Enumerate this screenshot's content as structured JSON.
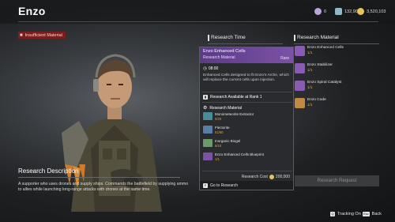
{
  "header": {
    "title": "Enzo",
    "currencies": [
      {
        "icon": "ticket-icon",
        "value": "0",
        "color": "#b9a3e0"
      },
      {
        "icon": "crystal-icon",
        "value": "132,908",
        "color": "#8fb8c9"
      },
      {
        "icon": "gold-coin-icon",
        "value": "3,520,103",
        "color": "#e8c25a"
      }
    ]
  },
  "status": {
    "insufficient": "Insufficient Material"
  },
  "research_time": {
    "label": "Research Time"
  },
  "research_material": {
    "label": "Research Material"
  },
  "materials": [
    {
      "name": "Enzo Enhanced Cells",
      "count": "1/1",
      "color": "#8a5bb5"
    },
    {
      "name": "Enzo Stabilizer",
      "count": "1/1",
      "color": "#8a5bb5"
    },
    {
      "name": "Enzo Spiral Catalyst",
      "count": "1/1",
      "color": "#8a5bb5"
    },
    {
      "name": "Enzo Code",
      "count": "1/1",
      "color": "#c08b3e"
    }
  ],
  "request_button": "Research Request",
  "popup": {
    "name": "Enzo Enhanced Cells",
    "type": "Research Material",
    "rarity": "Rare",
    "time": "08:00",
    "description": "Enhanced Cells designed to fit Enzo's Arche, which will replace the current cells upon injection.",
    "rank": "Research Available at Rank 1",
    "materials_label": "Research Material",
    "items": [
      {
        "name": "Monometeorite Extractor",
        "count": "0/20",
        "color": "#4a8b9a"
      },
      {
        "name": "Flectorite",
        "count": "51/60",
        "color": "#5a7fa6"
      },
      {
        "name": "Inorganic Biogel",
        "count": "9/10",
        "color": "#6a9c6a"
      },
      {
        "name": "Enzo Enhanced Cells Blueprint",
        "count": "1/1",
        "color": "#7b52a6"
      }
    ],
    "cost_label": "Research Cost",
    "cost_value": "200,000",
    "footer_key": "F",
    "footer_label": "Go to Research"
  },
  "description": {
    "title": "Research Description",
    "text": "A supporter who uses drones and supply ships. Commands the battlefield by supplying ammo to allies while launching long-range attacks with drones at the same time."
  },
  "bottom": {
    "tracking_key": "Q",
    "tracking": "Tracking On",
    "back_key": "Esc",
    "back": "Back"
  }
}
